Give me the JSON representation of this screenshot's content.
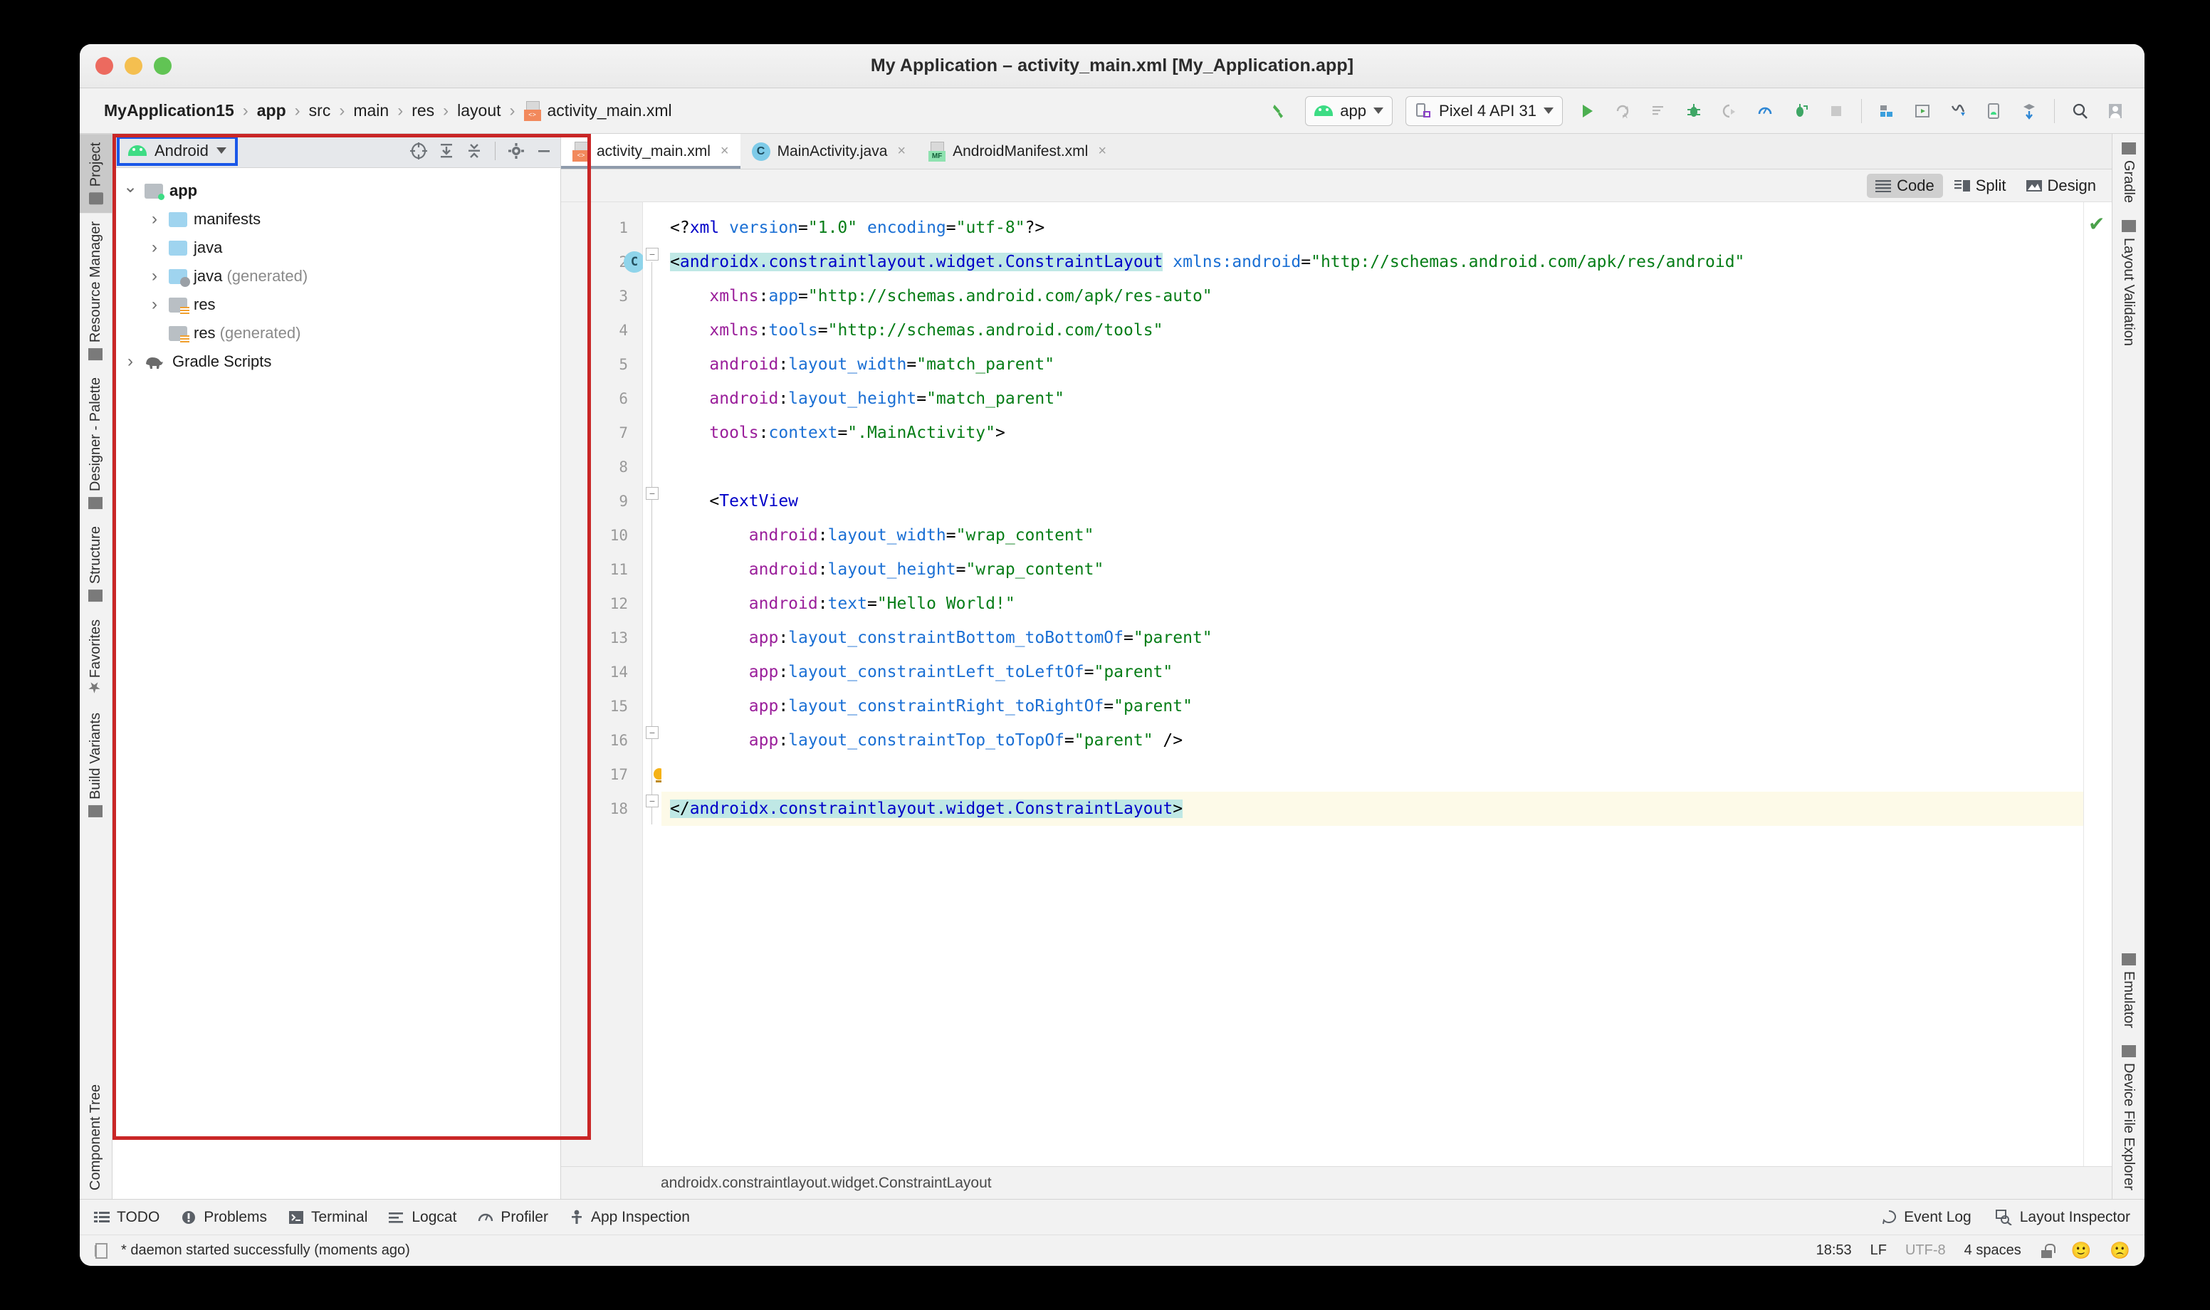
{
  "window": {
    "title": "My Application – activity_main.xml [My_Application.app]"
  },
  "breadcrumb": {
    "items": [
      "MyApplication15",
      "app",
      "src",
      "main",
      "res",
      "layout"
    ],
    "file": "activity_main.xml",
    "separator": "›"
  },
  "toolbar": {
    "build_icon": "hammer-icon",
    "run_config": "app",
    "device": "Pixel 4 API 31",
    "icons": [
      "run-icon",
      "apply-changes-icon",
      "apply-code-changes-icon",
      "debug-icon",
      "attach-debugger-icon",
      "profiler-icon",
      "run-with-coverage-icon",
      "stop-icon",
      "sdk-manager-icon",
      "avd-manager-icon",
      "device-manager-icon",
      "logcat-icon",
      "sync-gradle-icon",
      "search-icon",
      "avatar-icon"
    ]
  },
  "left_tool_tabs": [
    {
      "label": "Project",
      "icon": "folder-icon",
      "active": true
    },
    {
      "label": "Resource Manager",
      "icon": "resource-icon",
      "active": false
    },
    {
      "label": "Designer - Palette",
      "icon": "palette-icon",
      "active": false
    },
    {
      "label": "Structure",
      "icon": "structure-icon",
      "active": false
    },
    {
      "label": "Favorites",
      "icon": "star-icon",
      "active": false
    },
    {
      "label": "Build Variants",
      "icon": "android-icon",
      "active": false
    },
    {
      "label": "Component Tree",
      "icon": "tree-icon",
      "active": false
    }
  ],
  "right_tool_tabs_top": [
    {
      "label": "Gradle",
      "icon": "elephant-icon"
    },
    {
      "label": "Layout Validation",
      "icon": "layout-validation-icon"
    }
  ],
  "right_tool_tabs_bottom": [
    {
      "label": "Emulator",
      "icon": "emulator-icon"
    },
    {
      "label": "Device File Explorer",
      "icon": "device-file-icon"
    }
  ],
  "project_panel": {
    "view_selector": "Android",
    "view_selector_icon": "android-icon",
    "toolbar_icons": [
      "select-opened-file-icon",
      "expand-all-icon",
      "collapse-all-icon",
      "settings-gear-icon",
      "hide-icon"
    ],
    "tree": [
      {
        "label": "app",
        "suffix": "",
        "indent": 0,
        "chevron": "down",
        "icon": "module-folder-icon",
        "bold": true
      },
      {
        "label": "manifests",
        "suffix": "",
        "indent": 1,
        "chevron": "right",
        "icon": "folder-icon",
        "bold": false
      },
      {
        "label": "java",
        "suffix": "",
        "indent": 1,
        "chevron": "right",
        "icon": "folder-icon",
        "bold": false
      },
      {
        "label": "java",
        "suffix": " (generated)",
        "indent": 1,
        "chevron": "right",
        "icon": "generated-folder-icon",
        "bold": false
      },
      {
        "label": "res",
        "suffix": "",
        "indent": 1,
        "chevron": "right",
        "icon": "res-folder-icon",
        "bold": false
      },
      {
        "label": "res",
        "suffix": " (generated)",
        "indent": 1,
        "chevron": "blank",
        "icon": "res-folder-icon",
        "bold": false
      },
      {
        "label": "Gradle Scripts",
        "suffix": "",
        "indent": 0,
        "chevron": "right",
        "icon": "gradle-elephant-icon",
        "bold": false
      }
    ]
  },
  "editor_tabs": [
    {
      "label": "activity_main.xml",
      "icon": "xml-layout-icon",
      "active": true,
      "close": "×"
    },
    {
      "label": "MainActivity.java",
      "icon": "java-class-icon",
      "active": false,
      "close": "×"
    },
    {
      "label": "AndroidManifest.xml",
      "icon": "manifest-icon",
      "active": false,
      "close": "×"
    }
  ],
  "view_modes": [
    {
      "label": "Code",
      "icon": "code-icon",
      "active": true
    },
    {
      "label": "Split",
      "icon": "split-icon",
      "active": false
    },
    {
      "label": "Design",
      "icon": "design-icon",
      "active": false
    }
  ],
  "editor": {
    "file_status_icon": "green-check-icon",
    "breadcrumb": "androidx.constraintlayout.widget.ConstraintLayout",
    "gutter_markers": {
      "line2": "C"
    },
    "intention_bulb_line": 17,
    "lines": [
      {
        "n": 1,
        "indent": 0,
        "highlight": false,
        "tokens": [
          {
            "t": "<?",
            "c": "punct"
          },
          {
            "t": "xml",
            "c": "tag"
          },
          {
            "t": " ",
            "c": "punct"
          },
          {
            "t": "version",
            "c": "ns"
          },
          {
            "t": "=",
            "c": "punct"
          },
          {
            "t": "\"1.0\"",
            "c": "str"
          },
          {
            "t": " ",
            "c": "punct"
          },
          {
            "t": "encoding",
            "c": "ns"
          },
          {
            "t": "=",
            "c": "punct"
          },
          {
            "t": "\"utf-8\"",
            "c": "str"
          },
          {
            "t": "?>",
            "c": "punct"
          }
        ]
      },
      {
        "n": 2,
        "indent": 0,
        "highlight": false,
        "tokens": [
          {
            "t": "<",
            "c": "punct",
            "sel": true
          },
          {
            "t": "androidx.constraintlayout.widget.ConstraintLayout",
            "c": "tag",
            "sel": true
          },
          {
            "t": " ",
            "c": "punct"
          },
          {
            "t": "xmlns:android",
            "c": "ns"
          },
          {
            "t": "=",
            "c": "punct"
          },
          {
            "t": "\"http://schemas.android.com/apk/res/android\"",
            "c": "str"
          }
        ]
      },
      {
        "n": 3,
        "indent": 1,
        "highlight": false,
        "tokens": [
          {
            "t": "xmlns",
            "c": "attr"
          },
          {
            "t": ":",
            "c": "punct"
          },
          {
            "t": "app",
            "c": "ns"
          },
          {
            "t": "=",
            "c": "punct"
          },
          {
            "t": "\"http://schemas.android.com/apk/res-auto\"",
            "c": "str"
          }
        ]
      },
      {
        "n": 4,
        "indent": 1,
        "highlight": false,
        "tokens": [
          {
            "t": "xmlns",
            "c": "attr"
          },
          {
            "t": ":",
            "c": "punct"
          },
          {
            "t": "tools",
            "c": "ns"
          },
          {
            "t": "=",
            "c": "punct"
          },
          {
            "t": "\"http://schemas.android.com/tools\"",
            "c": "str"
          }
        ]
      },
      {
        "n": 5,
        "indent": 1,
        "highlight": false,
        "tokens": [
          {
            "t": "android",
            "c": "attr"
          },
          {
            "t": ":",
            "c": "punct"
          },
          {
            "t": "layout_width",
            "c": "ns"
          },
          {
            "t": "=",
            "c": "punct"
          },
          {
            "t": "\"match_parent\"",
            "c": "str"
          }
        ]
      },
      {
        "n": 6,
        "indent": 1,
        "highlight": false,
        "tokens": [
          {
            "t": "android",
            "c": "attr"
          },
          {
            "t": ":",
            "c": "punct"
          },
          {
            "t": "layout_height",
            "c": "ns"
          },
          {
            "t": "=",
            "c": "punct"
          },
          {
            "t": "\"match_parent\"",
            "c": "str"
          }
        ]
      },
      {
        "n": 7,
        "indent": 1,
        "highlight": false,
        "tokens": [
          {
            "t": "tools",
            "c": "attr"
          },
          {
            "t": ":",
            "c": "punct"
          },
          {
            "t": "context",
            "c": "ns"
          },
          {
            "t": "=",
            "c": "punct"
          },
          {
            "t": "\".MainActivity\"",
            "c": "str"
          },
          {
            "t": ">",
            "c": "punct"
          }
        ]
      },
      {
        "n": 8,
        "indent": 0,
        "highlight": false,
        "tokens": []
      },
      {
        "n": 9,
        "indent": 1,
        "highlight": false,
        "tokens": [
          {
            "t": "<",
            "c": "punct"
          },
          {
            "t": "TextView",
            "c": "tag"
          }
        ]
      },
      {
        "n": 10,
        "indent": 2,
        "highlight": false,
        "tokens": [
          {
            "t": "android",
            "c": "attr"
          },
          {
            "t": ":",
            "c": "punct"
          },
          {
            "t": "layout_width",
            "c": "ns"
          },
          {
            "t": "=",
            "c": "punct"
          },
          {
            "t": "\"wrap_content\"",
            "c": "str"
          }
        ]
      },
      {
        "n": 11,
        "indent": 2,
        "highlight": false,
        "tokens": [
          {
            "t": "android",
            "c": "attr"
          },
          {
            "t": ":",
            "c": "punct"
          },
          {
            "t": "layout_height",
            "c": "ns"
          },
          {
            "t": "=",
            "c": "punct"
          },
          {
            "t": "\"wrap_content\"",
            "c": "str"
          }
        ]
      },
      {
        "n": 12,
        "indent": 2,
        "highlight": false,
        "tokens": [
          {
            "t": "android",
            "c": "attr"
          },
          {
            "t": ":",
            "c": "punct"
          },
          {
            "t": "text",
            "c": "ns"
          },
          {
            "t": "=",
            "c": "punct"
          },
          {
            "t": "\"Hello World!\"",
            "c": "str"
          }
        ]
      },
      {
        "n": 13,
        "indent": 2,
        "highlight": false,
        "tokens": [
          {
            "t": "app",
            "c": "attr"
          },
          {
            "t": ":",
            "c": "punct"
          },
          {
            "t": "layout_constraintBottom_toBottomOf",
            "c": "ns"
          },
          {
            "t": "=",
            "c": "punct"
          },
          {
            "t": "\"parent\"",
            "c": "str"
          }
        ]
      },
      {
        "n": 14,
        "indent": 2,
        "highlight": false,
        "tokens": [
          {
            "t": "app",
            "c": "attr"
          },
          {
            "t": ":",
            "c": "punct"
          },
          {
            "t": "layout_constraintLeft_toLeftOf",
            "c": "ns"
          },
          {
            "t": "=",
            "c": "punct"
          },
          {
            "t": "\"parent\"",
            "c": "str"
          }
        ]
      },
      {
        "n": 15,
        "indent": 2,
        "highlight": false,
        "tokens": [
          {
            "t": "app",
            "c": "attr"
          },
          {
            "t": ":",
            "c": "punct"
          },
          {
            "t": "layout_constraintRight_toRightOf",
            "c": "ns"
          },
          {
            "t": "=",
            "c": "punct"
          },
          {
            "t": "\"parent\"",
            "c": "str"
          }
        ]
      },
      {
        "n": 16,
        "indent": 2,
        "highlight": false,
        "tokens": [
          {
            "t": "app",
            "c": "attr"
          },
          {
            "t": ":",
            "c": "punct"
          },
          {
            "t": "layout_constraintTop_toTopOf",
            "c": "ns"
          },
          {
            "t": "=",
            "c": "punct"
          },
          {
            "t": "\"parent\"",
            "c": "str"
          },
          {
            "t": " />",
            "c": "punct"
          }
        ]
      },
      {
        "n": 17,
        "indent": 0,
        "highlight": false,
        "tokens": []
      },
      {
        "n": 18,
        "indent": 0,
        "highlight": true,
        "tokens": [
          {
            "t": "</",
            "c": "punct",
            "sel": true
          },
          {
            "t": "androidx.constraintlayout.widget.ConstraintLayout",
            "c": "tag",
            "sel": true
          },
          {
            "t": ">",
            "c": "punct",
            "sel": true
          }
        ]
      }
    ]
  },
  "bottom_tabs": [
    {
      "label": "TODO",
      "icon": "todo-icon"
    },
    {
      "label": "Problems",
      "icon": "problems-icon"
    },
    {
      "label": "Terminal",
      "icon": "terminal-icon"
    },
    {
      "label": "Logcat",
      "icon": "logcat-icon"
    },
    {
      "label": "Profiler",
      "icon": "profiler-icon"
    },
    {
      "label": "App Inspection",
      "icon": "app-inspection-icon"
    }
  ],
  "bottom_tabs_right": [
    {
      "label": "Event Log",
      "icon": "event-log-icon"
    },
    {
      "label": "Layout Inspector",
      "icon": "layout-inspector-icon"
    }
  ],
  "status": {
    "message": "* daemon started successfully (moments ago)",
    "message_icon": "console-icon",
    "time": "18:53",
    "line_separator": "LF",
    "encoding": "UTF-8",
    "indent": "4 spaces",
    "lock_icon": "unlocked-icon",
    "happy_icon": "🙂",
    "sad_icon": "🙁"
  },
  "annotations": {
    "project_panel_highlight_color": "#c92626",
    "view_selector_highlight_color": "#1a57e8"
  }
}
